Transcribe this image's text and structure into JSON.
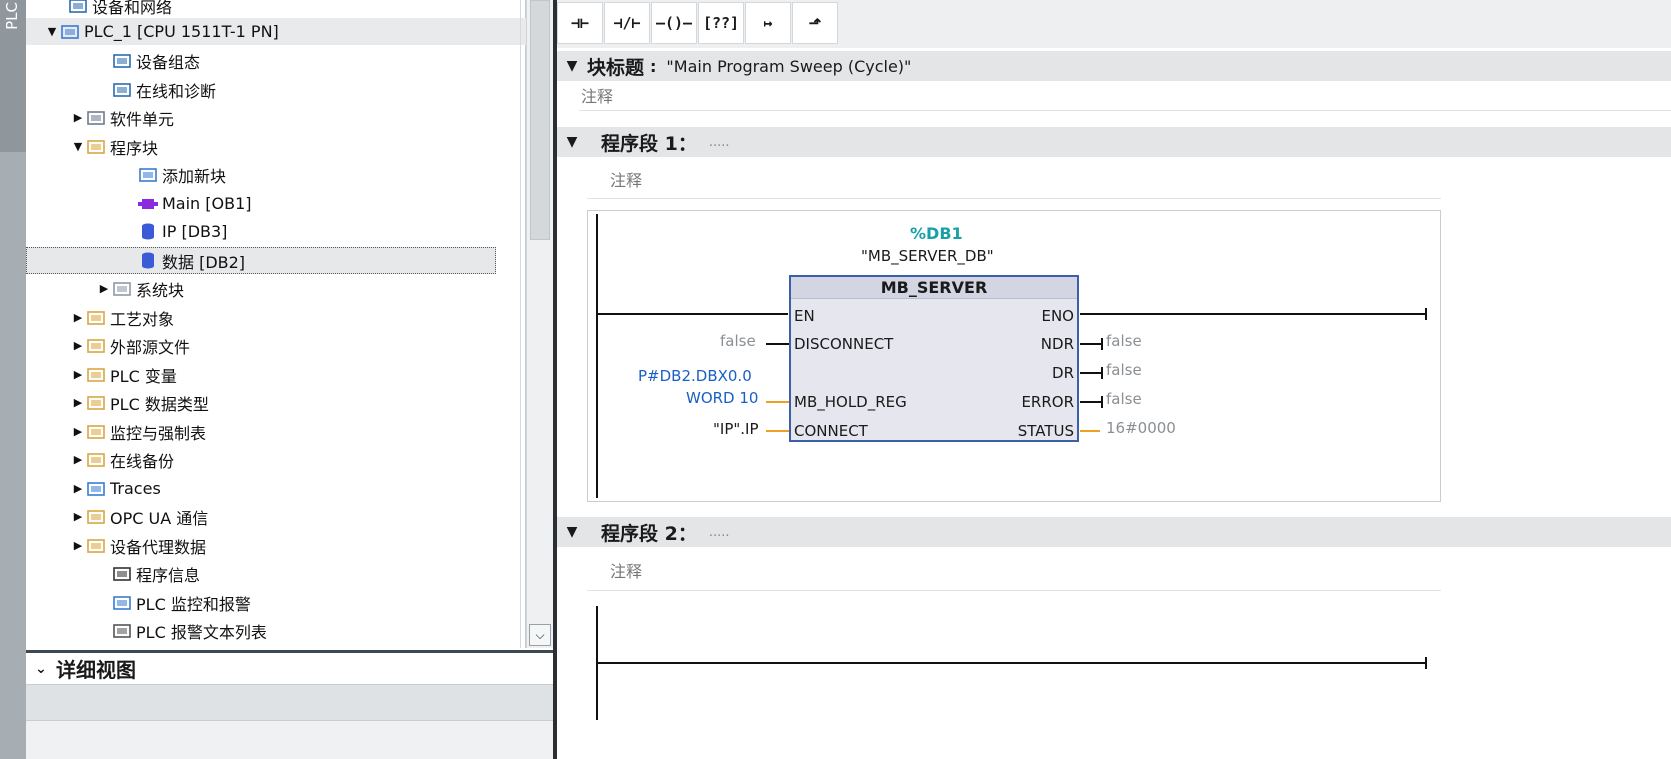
{
  "vstrip": {
    "label": "PLC"
  },
  "tree": {
    "items": [
      {
        "label": "设备和网络",
        "icon": "network-icon",
        "twisty": ""
      },
      {
        "label": "PLC_1 [CPU 1511T-1 PN]",
        "icon": "cpu-icon",
        "twisty": "▼"
      },
      {
        "label": "设备组态",
        "icon": "device-config-icon",
        "twisty": ""
      },
      {
        "label": "在线和诊断",
        "icon": "diagnostics-icon",
        "twisty": ""
      },
      {
        "label": "软件单元",
        "icon": "software-units-icon",
        "twisty": "▶"
      },
      {
        "label": "程序块",
        "icon": "program-blocks-folder-icon",
        "twisty": "▼"
      },
      {
        "label": "添加新块",
        "icon": "add-block-icon",
        "twisty": ""
      },
      {
        "label": "Main [OB1]",
        "icon": "ob-icon",
        "twisty": ""
      },
      {
        "label": "IP [DB3]",
        "icon": "db-icon",
        "twisty": ""
      },
      {
        "label": "数据 [DB2]",
        "icon": "db-icon",
        "twisty": ""
      },
      {
        "label": "系统块",
        "icon": "system-blocks-icon",
        "twisty": "▶"
      },
      {
        "label": "工艺对象",
        "icon": "technology-objects-icon",
        "twisty": "▶"
      },
      {
        "label": "外部源文件",
        "icon": "external-source-icon",
        "twisty": "▶"
      },
      {
        "label": "PLC 变量",
        "icon": "plc-tags-icon",
        "twisty": "▶"
      },
      {
        "label": "PLC 数据类型",
        "icon": "plc-datatypes-icon",
        "twisty": "▶"
      },
      {
        "label": "监控与强制表",
        "icon": "watch-tables-icon",
        "twisty": "▶"
      },
      {
        "label": "在线备份",
        "icon": "online-backup-icon",
        "twisty": "▶"
      },
      {
        "label": "Traces",
        "icon": "traces-icon",
        "twisty": "▶"
      },
      {
        "label": "OPC UA 通信",
        "icon": "opcua-icon",
        "twisty": "▶"
      },
      {
        "label": "设备代理数据",
        "icon": "device-proxy-icon",
        "twisty": "▶"
      },
      {
        "label": "程序信息",
        "icon": "program-info-icon",
        "twisty": ""
      },
      {
        "label": "PLC 监控和报警",
        "icon": "plc-alarms-icon",
        "twisty": ""
      },
      {
        "label": "PLC 报警文本列表",
        "icon": "alarm-text-icon",
        "twisty": ""
      }
    ]
  },
  "detail": {
    "title": "详细视图",
    "chevron": "⌄"
  },
  "toolbar": {
    "buttons": [
      {
        "label": "⊣⊢",
        "icon": "no-contact-icon"
      },
      {
        "label": "⊣/⊢",
        "icon": "nc-contact-icon"
      },
      {
        "label": "–()–",
        "icon": "coil-icon"
      },
      {
        "label": "[??]",
        "icon": "empty-box-icon"
      },
      {
        "label": "↦",
        "icon": "open-branch-icon"
      },
      {
        "label": "⬏",
        "icon": "close-branch-icon"
      }
    ]
  },
  "block": {
    "title_label": "块标题",
    "colon": ":",
    "title_value": "\"Main Program Sweep (Cycle)\"",
    "comment": "注释"
  },
  "networks": [
    {
      "label": "程序段 1：",
      "dots": ".....",
      "comment": "注释"
    },
    {
      "label": "程序段 2：",
      "dots": ".....",
      "comment": "注释"
    }
  ],
  "fb": {
    "db_number": "%DB1",
    "db_name": "\"MB_SERVER_DB\"",
    "name": "MB_SERVER",
    "inputs": [
      "EN",
      "DISCONNECT",
      "MB_HOLD_REG",
      "CONNECT"
    ],
    "outputs": [
      "ENO",
      "NDR",
      "DR",
      "ERROR",
      "STATUS"
    ],
    "in_values": {
      "disconnect": "false",
      "hold_reg_1": "P#DB2.DBX0.0",
      "hold_reg_2": "WORD 10",
      "connect": "\"IP\".IP"
    },
    "out_values": {
      "ndr": "false",
      "dr": "false",
      "error": "false",
      "status": "16#0000"
    }
  },
  "colors": {
    "db_number": "#1a9fa8",
    "block_border": "#3b5fa8",
    "param_blue": "#1b5fc2",
    "wire_orange": "#f0a020"
  }
}
